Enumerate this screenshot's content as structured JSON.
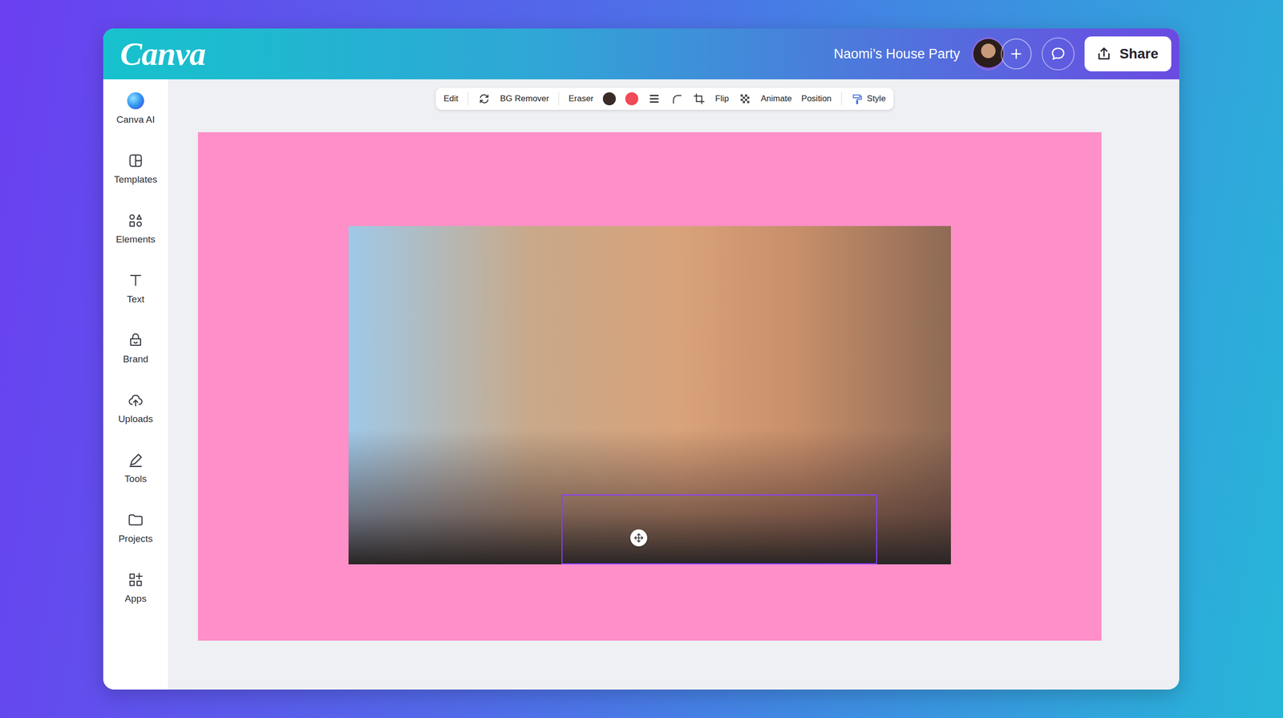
{
  "app": {
    "logo": "Canva"
  },
  "header": {
    "title": "Naomi’s House Party",
    "share": "Share"
  },
  "sidebar": {
    "items": [
      {
        "label": "Canva AI"
      },
      {
        "label": "Templates"
      },
      {
        "label": "Elements"
      },
      {
        "label": "Text"
      },
      {
        "label": "Brand"
      },
      {
        "label": "Uploads"
      },
      {
        "label": "Tools"
      },
      {
        "label": "Projects"
      },
      {
        "label": "Apps"
      }
    ]
  },
  "toolbar": {
    "edit": "Edit",
    "bg_remover": "BG Remover",
    "eraser": "Eraser",
    "swatches": [
      {
        "color": "#3b2b28"
      },
      {
        "color": "#ef4a55"
      }
    ],
    "flip": "Flip",
    "animate": "Animate",
    "position": "Position",
    "style": "Style"
  }
}
